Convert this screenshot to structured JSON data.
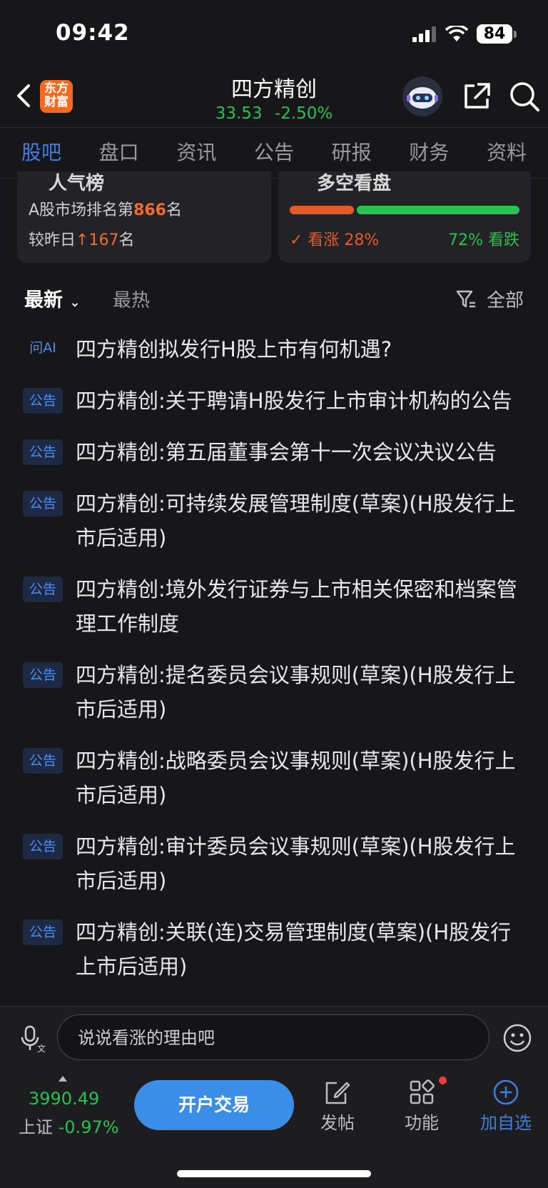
{
  "status": {
    "time": "09:42",
    "battery": "84"
  },
  "header": {
    "logo_line1": "东方",
    "logo_line2": "财富",
    "stock_name": "四方精创",
    "price": "33.53",
    "change_pct": "-2.50%"
  },
  "tabs": [
    {
      "label": "股吧",
      "active": true
    },
    {
      "label": "盘口"
    },
    {
      "label": "资讯"
    },
    {
      "label": "公告"
    },
    {
      "label": "研报"
    },
    {
      "label": "财务"
    },
    {
      "label": "资料"
    }
  ],
  "popularity_card": {
    "title_partial": "人气榜",
    "rank_prefix": "A股市场排名第",
    "rank_value": "866",
    "rank_suffix": "名",
    "change_prefix": "较昨日",
    "change_arrow": "↑",
    "change_value": "167",
    "change_suffix": "名"
  },
  "sentiment_card": {
    "title_partial": "多空看盘",
    "up_label": "✓ 看涨 28%",
    "down_label": "72% 看跌",
    "up_fraction": 0.28,
    "down_fraction": 0.72
  },
  "filters": {
    "latest": "最新",
    "hot": "最热",
    "all": "全部"
  },
  "posts": [
    {
      "tag": "问AI",
      "title": "四方精创拟发行H股上市有何机遇?"
    },
    {
      "tag": "公告",
      "title": "四方精创:关于聘请H股发行上市审计机构的公告"
    },
    {
      "tag": "公告",
      "title": "四方精创:第五届董事会第十一次会议决议公告"
    },
    {
      "tag": "公告",
      "title": "四方精创:可持续发展管理制度(草案)(H股发行上市后适用)"
    },
    {
      "tag": "公告",
      "title": "四方精创:境外发行证券与上市相关保密和档案管理工作制度"
    },
    {
      "tag": "公告",
      "title": "四方精创:提名委员会议事规则(草案)(H股发行上市后适用)"
    },
    {
      "tag": "公告",
      "title": "四方精创:战略委员会议事规则(草案)(H股发行上市后适用)"
    },
    {
      "tag": "公告",
      "title": "四方精创:审计委员会议事规则(草案)(H股发行上市后适用)"
    },
    {
      "tag": "公告",
      "title": "四方精创:关联(连)交易管理制度(草案)(H股发行上市后适用)"
    }
  ],
  "comment": {
    "placeholder": "说说看涨的理由吧"
  },
  "bottom": {
    "index_value": "3990.49",
    "index_name": "上证",
    "index_change": "-0.97%",
    "open_account": "开户交易",
    "post": "发帖",
    "functions": "功能",
    "add_watch": "加自选"
  },
  "colors": {
    "up_red": "#e65a28",
    "down_green": "#27c24f",
    "accent_blue": "#3d7fe0",
    "background": "#17171a"
  }
}
